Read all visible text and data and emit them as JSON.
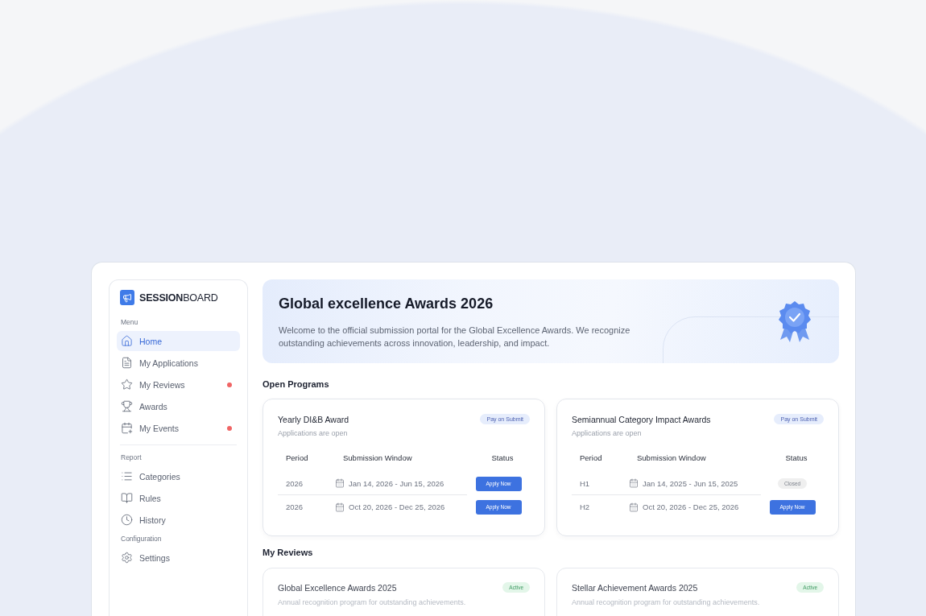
{
  "brand": {
    "bold": "SESSION",
    "light": "BOARD"
  },
  "sidebar": {
    "sections": [
      {
        "title": "Menu",
        "items": [
          {
            "label": "Home",
            "selected": true,
            "notification": false
          },
          {
            "label": "My Applications",
            "selected": false,
            "notification": false
          },
          {
            "label": "My Reviews",
            "selected": false,
            "notification": true
          },
          {
            "label": "Awards",
            "selected": false,
            "notification": false
          },
          {
            "label": "My Events",
            "selected": false,
            "notification": true
          }
        ]
      },
      {
        "title": "Report",
        "items": [
          {
            "label": "Categories",
            "selected": false,
            "notification": false
          },
          {
            "label": "Rules",
            "selected": false,
            "notification": false
          },
          {
            "label": "History",
            "selected": false,
            "notification": false
          }
        ]
      },
      {
        "title": "Configuration",
        "items": [
          {
            "label": "Settings",
            "selected": false,
            "notification": false
          }
        ]
      }
    ]
  },
  "banner": {
    "title": "Global excellence Awards 2026",
    "description": "Welcome to the official submission portal for the Global Excellence Awards. We recognize outstanding achievements across innovation, leadership, and impact."
  },
  "open_programs": {
    "title": "Open Programs",
    "programs": [
      {
        "title": "Yearly DI&B Award",
        "tag": "Pay on Submit",
        "subtitle": "Applications are open",
        "columns": [
          "Period",
          "Submission Window",
          "Status"
        ],
        "rows": [
          {
            "period": "2026",
            "window": "Jan 14, 2026 - Jun 15, 2026",
            "status": {
              "kind": "button",
              "label": "Apply Now"
            }
          },
          {
            "period": "2026",
            "window": "Oct 20, 2026 - Dec 25, 2026",
            "status": {
              "kind": "button",
              "label": "Apply Now"
            }
          }
        ]
      },
      {
        "title": "Semiannual Category Impact Awards",
        "tag": "Pay on Submit",
        "subtitle": "Applications are open",
        "columns": [
          "Period",
          "Submission Window",
          "Status"
        ],
        "rows": [
          {
            "period": "H1",
            "window": "Jan 14, 2025 - Jun 15, 2025",
            "status": {
              "kind": "badge",
              "label": "Closed"
            }
          },
          {
            "period": "H2",
            "window": "Oct 20, 2026 - Dec 25, 2026",
            "status": {
              "kind": "button",
              "label": "Apply Now"
            }
          }
        ]
      }
    ]
  },
  "my_reviews": {
    "title": "My Reviews",
    "reviews": [
      {
        "title": "Global Excellence Awards 2025",
        "status": "Active",
        "description": "Annual recognition program for outstanding achievements."
      },
      {
        "title": "Stellar Achievement Awards 2025",
        "status": "Active",
        "description": "Annual recognition program for outstanding achievements."
      }
    ]
  }
}
